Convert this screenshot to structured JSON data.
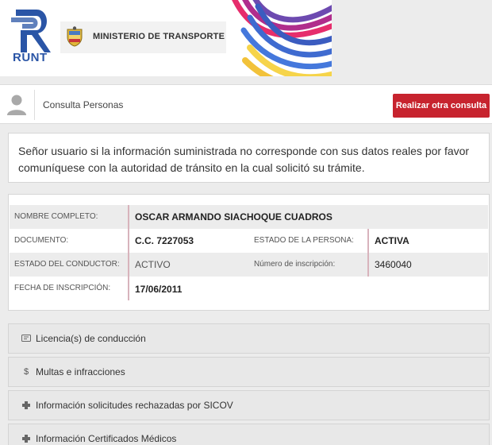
{
  "header": {
    "runt_text": "RUNT",
    "ministry_text": "MINISTERIO DE TRANSPORTE"
  },
  "consulta": {
    "title": "Consulta Personas",
    "button_label": "Realizar otra consulta"
  },
  "notice": {
    "text": "Señor usuario si la información suministrada no corresponde con sus datos reales por favor comuníquese con la autoridad de tránsito en la cual solicitó su trámite."
  },
  "person": {
    "nombre_label": "NOMBRE COMPLETO:",
    "nombre_value": "OSCAR ARMANDO SIACHOQUE CUADROS",
    "documento_label": "DOCUMENTO:",
    "documento_value": "C.C. 7227053",
    "estado_persona_label": "ESTADO DE LA PERSONA:",
    "estado_persona_value": "ACTIVA",
    "estado_conductor_label": "ESTADO DEL CONDUCTOR:",
    "estado_conductor_value": "ACTIVO",
    "inscripcion_num_label": "Número de inscripción:",
    "inscripcion_num_value": "3460040",
    "fecha_label": "FECHA DE INSCRIPCIÓN:",
    "fecha_value": "17/06/2011"
  },
  "accordion": [
    {
      "icon": "id-card-icon",
      "label": "Licencia(s) de conducción"
    },
    {
      "icon": "dollar-icon",
      "label": "Multas e infracciones"
    },
    {
      "icon": "medical-cross-icon",
      "label": "Información solicitudes rechazadas por SICOV"
    },
    {
      "icon": "medical-cross-icon",
      "label": "Información Certificados Médicos"
    }
  ],
  "colors": {
    "accent_red": "#c7232e",
    "runt_blue": "#2a55a6",
    "divider_pink": "#d8b3bc"
  }
}
